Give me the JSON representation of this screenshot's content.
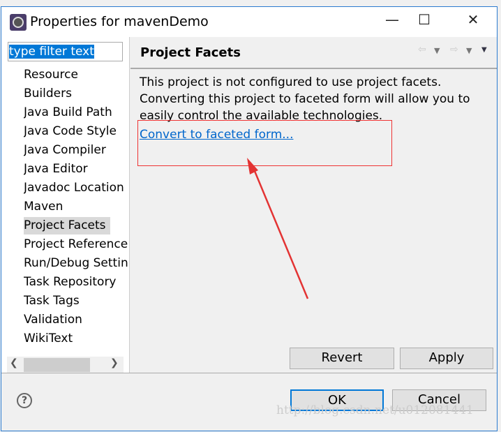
{
  "window": {
    "title": "Properties for mavenDemo",
    "minimize": "—",
    "maximize": "☐",
    "close": "✕"
  },
  "filter": {
    "value": "type filter text"
  },
  "sidebar": {
    "items": [
      "Resource",
      "Builders",
      "Java Build Path",
      "Java Code Style",
      "Java Compiler",
      "Java Editor",
      "Javadoc Location",
      "Maven",
      "Project Facets",
      "Project References",
      "Run/Debug Settings",
      "Task Repository",
      "Task Tags",
      "Validation",
      "WikiText"
    ],
    "selected": "Project Facets"
  },
  "page": {
    "title": "Project Facets",
    "description": "This project is not configured to use project facets. Converting this project to faceted form will allow you to easily control the available technologies.",
    "link": "Convert to faceted form...",
    "revert": "Revert",
    "apply": "Apply"
  },
  "footer": {
    "ok": "OK",
    "cancel": "Cancel",
    "help": "?"
  },
  "watermark": "http://blog.csdn.net/u012081441",
  "annotation_color": "#e33333"
}
